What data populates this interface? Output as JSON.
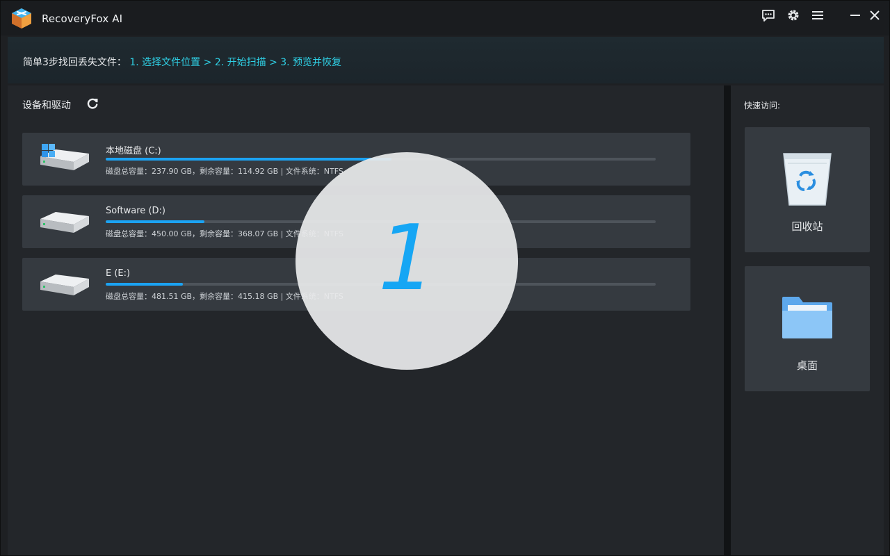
{
  "app": {
    "title": "RecoveryFox AI"
  },
  "titlebar": {
    "icons": [
      "feedback-icon",
      "settings-icon",
      "menu-icon",
      "minimize-icon",
      "close-icon"
    ]
  },
  "banner": {
    "prefix": "简单3步找回丢失文件：",
    "steps": "1. 选择文件位置 > 2. 开始扫描 > 3. 预览并恢复"
  },
  "devices": {
    "title": "设备和驱动",
    "drives": [
      {
        "name": "本地磁盘 (C:)",
        "info": "磁盘总容量：237.90 GB，剩余容量：114.92 GB | 文件系统：NTFS",
        "used_fraction": 0.52,
        "system": true
      },
      {
        "name": "Software (D:)",
        "info": "磁盘总容量：450.00 GB，剩余容量：368.07 GB | 文件系统：NTFS",
        "used_fraction": 0.18,
        "system": false
      },
      {
        "name": "E (E:)",
        "info": "磁盘总容量：481.51 GB，剩余容量：415.18 GB | 文件系统：NTFS",
        "used_fraction": 0.14,
        "system": false
      }
    ]
  },
  "quick_access": {
    "title": "快速访问:",
    "items": [
      {
        "label": "回收站",
        "icon": "recycle-bin-icon"
      },
      {
        "label": "桌面",
        "icon": "folder-icon"
      }
    ]
  },
  "overlay": {
    "step_number": "1"
  },
  "colors": {
    "accent": "#1ba3f3",
    "steps_text": "#2fd1e6"
  }
}
